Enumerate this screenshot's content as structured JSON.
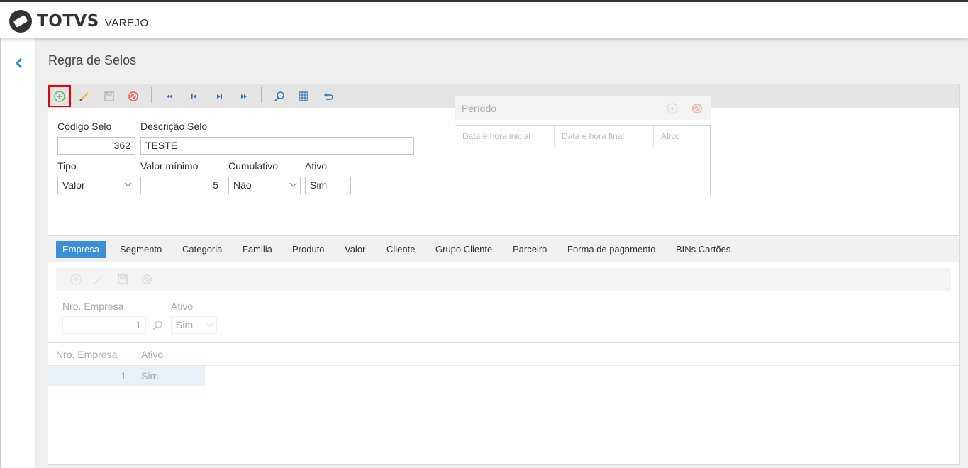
{
  "app": {
    "brand": "TOTVS",
    "brand_sub": "VAREJO"
  },
  "page": {
    "title": "Regra de Selos"
  },
  "toolbar": {
    "buttons": [
      "add-icon",
      "edit-icon",
      "save-icon",
      "cancel-icon",
      "first-icon",
      "previous-icon",
      "next-icon",
      "last-icon",
      "search-icon",
      "grid-icon",
      "undo-icon"
    ]
  },
  "form": {
    "codigo_label": "Código Selo",
    "codigo_value": "362",
    "descricao_label": "Descrição Selo",
    "descricao_value": "TESTE",
    "tipo_label": "Tipo",
    "tipo_value": "Valor",
    "valor_minimo_label": "Valor mínimo",
    "valor_minimo_value": "5",
    "cumulativo_label": "Cumulativo",
    "cumulativo_value": "Não",
    "ativo_label": "Ativo",
    "ativo_value": "Sim"
  },
  "periodo": {
    "title": "Período",
    "columns": [
      "Data e hora inicial",
      "Data e hora final",
      "Ativo"
    ]
  },
  "tabs": [
    {
      "label": "Empresa",
      "active": true
    },
    {
      "label": "Segmento"
    },
    {
      "label": "Categoria"
    },
    {
      "label": "Familia"
    },
    {
      "label": "Produto"
    },
    {
      "label": "Valor"
    },
    {
      "label": "Cliente"
    },
    {
      "label": "Grupo Cliente"
    },
    {
      "label": "Parceiro"
    },
    {
      "label": "Forma de pagamento"
    },
    {
      "label": "BINs Cartões"
    }
  ],
  "empresa": {
    "nro_label": "Nro. Empresa",
    "nro_value": "1",
    "ativo_label": "Ativo",
    "ativo_value": "Sim",
    "grid_columns": [
      "Nro. Empresa",
      "Ativo"
    ],
    "rows": [
      {
        "nro": "1",
        "ativo": "Sim"
      }
    ]
  },
  "colors": {
    "accent": "#3a8fd6",
    "highlight": "#e00000",
    "add_green": "#4caf50",
    "cancel_red": "#e05656"
  }
}
